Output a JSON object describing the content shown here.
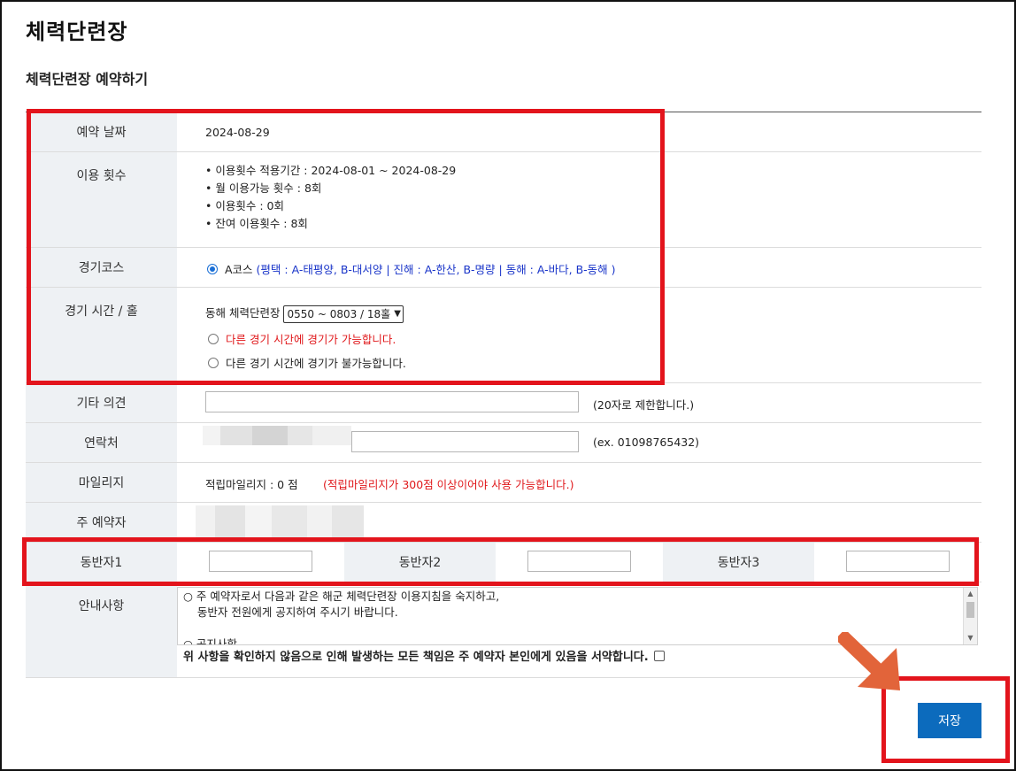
{
  "page": {
    "title": "체력단련장",
    "section_title": "체력단련장 예약하기"
  },
  "form": {
    "date": {
      "label": "예약 날짜",
      "value": "2024-08-29"
    },
    "usage": {
      "label": "이용 횟수",
      "lines": [
        "• 이용횟수 적용기간 : 2024-08-01 ~ 2024-08-29",
        "• 월 이용가능 횟수 : 8회",
        "• 이용횟수 : 0회",
        "• 잔여 이용횟수 : 8회"
      ]
    },
    "course": {
      "label": "경기코스",
      "option_label": "A코스",
      "option_detail": "(평택 : A-태평양, B-대서양 | 진해 : A-한산, B-명량 | 동해 : A-바다, B-동해 )"
    },
    "time": {
      "label": "경기 시간 / 홀",
      "venue": "동해 체력단련장",
      "selected": "0550 ~ 0803 / 18홀",
      "option_possible": "다른 경기 시간에 경기가 가능합니다.",
      "option_impossible": "다른 경기 시간에 경기가 불가능합니다."
    },
    "comment": {
      "label": "기타 의견",
      "value": "",
      "hint": "(20자로 제한합니다.)"
    },
    "contact": {
      "label": "연락처",
      "hint": "(ex. 01098765432)"
    },
    "mileage": {
      "label": "마일리지",
      "value": "적립마일리지 : 0 점",
      "note": "(적립마일리지가 300점 이상이어야 사용 가능합니다.)"
    },
    "booker": {
      "label": "주 예약자"
    },
    "companions": {
      "labels": [
        "동반자1",
        "동반자2",
        "동반자3"
      ],
      "values": [
        "",
        "",
        ""
      ]
    },
    "notice": {
      "label": "안내사항",
      "lines": [
        "○ 주 예약자로서 다음과 같은 해군 체력단련장 이용지침을 숙지하고,",
        "    동반자 전원에게 공지하여 주시기 바랍니다.",
        "",
        "○ 공지사항"
      ],
      "agreement": "위 사항을 확인하지 않음으로 인해 발생하는 모든 책임은 주 예약자 본인에게 있음을 서약합니다."
    }
  },
  "actions": {
    "save_label": "저장"
  },
  "colors": {
    "highlight": "#e3141c",
    "primary_button": "#0c6bbd",
    "label_bg": "#eef1f4",
    "course_text": "#1a35c9",
    "warning_text": "#e0181b",
    "annotation_arrow": "#e2643a"
  },
  "icons": {
    "radio_selected": "radio-checked-icon",
    "radio_empty": "radio-empty-icon",
    "dropdown": "chevron-down-icon",
    "pointer": "arrow-down-right-icon"
  }
}
